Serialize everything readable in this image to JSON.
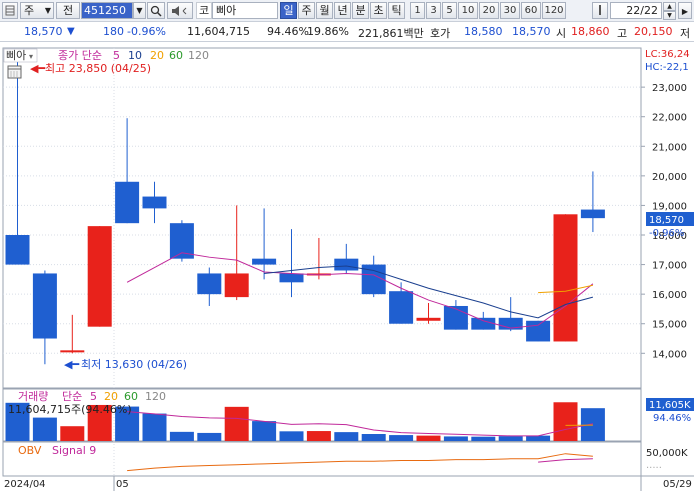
{
  "toolbar": {
    "market": "주",
    "prev_label": "전",
    "code": "451250",
    "exchange": "코",
    "stock_name": "삐아",
    "periods": [
      "일",
      "주",
      "월",
      "년",
      "분",
      "초",
      "틱"
    ],
    "selected_period": "일",
    "intervals": [
      "1",
      "3",
      "5",
      "10",
      "20",
      "30",
      "60",
      "120"
    ],
    "count": "22/22"
  },
  "quote": {
    "price": "18,570",
    "change": "180",
    "change_pct": "-0.96%",
    "volume": "11,604,715",
    "volume_ratio": "94.46%",
    "turnover": "19.86%",
    "amount": "221,861백만",
    "bid_label": "호가",
    "ask_price": "18,580",
    "bid_price": "18,570",
    "open_label": "시",
    "open": "18,860",
    "high_label": "고",
    "high": "20,150",
    "low_label": "저"
  },
  "price_pane": {
    "title": "삐아",
    "ma_label": "종가 단순",
    "ma_periods": [
      "5",
      "10",
      "20",
      "60",
      "120"
    ],
    "lc": "LC:36,24",
    "hc": "HC:-22,1",
    "high_note": "최고 23,850 (04/25)",
    "low_note": "최저 13,630 (04/26)",
    "current_price_tag": "18,570",
    "current_pct_tag": "-0.96%",
    "y_ticks": [
      "23,000",
      "22,000",
      "21,000",
      "20,000",
      "19,000",
      "18,000",
      "17,000",
      "16,000",
      "15,000",
      "14,000"
    ]
  },
  "volume_pane": {
    "title": "거래량",
    "ma_label": "단순",
    "ma_periods": [
      "5",
      "20",
      "60",
      "120"
    ],
    "value_note": "11,604,715주(94.46%)",
    "tag_value": "11,605K",
    "tag_pct": "94.46%"
  },
  "obv_pane": {
    "title": "OBV",
    "signal": "Signal 9",
    "y_tick": "50,000K"
  },
  "x_axis": {
    "labels": [
      "2024/04",
      "05",
      "05/29"
    ]
  },
  "colors": {
    "up": "#e8221b",
    "down": "#1f5fd0",
    "ma5": "#c0289a",
    "ma10": "#1a3f8f",
    "ma20": "#f0a000",
    "ma60": "#2b9a2b"
  },
  "chart_data": {
    "type": "candlestick",
    "days": [
      {
        "o": 18000,
        "h": 23850,
        "l": 18000,
        "c": 17000
      },
      {
        "o": 16700,
        "h": 16800,
        "l": 13630,
        "c": 14500
      },
      {
        "o": 14100,
        "h": 15300,
        "l": 14000,
        "c": 14100
      },
      {
        "o": 14900,
        "h": 18300,
        "l": 14900,
        "c": 18300
      },
      {
        "o": 19800,
        "h": 21950,
        "l": 18400,
        "c": 18400
      },
      {
        "o": 19300,
        "h": 19800,
        "l": 18400,
        "c": 18900
      },
      {
        "o": 18400,
        "h": 18500,
        "l": 17100,
        "c": 17200
      },
      {
        "o": 16700,
        "h": 16900,
        "l": 15600,
        "c": 16000
      },
      {
        "o": 15900,
        "h": 19000,
        "l": 15800,
        "c": 16700
      },
      {
        "o": 17200,
        "h": 18900,
        "l": 16500,
        "c": 17000
      },
      {
        "o": 16700,
        "h": 18200,
        "l": 15900,
        "c": 16400
      },
      {
        "o": 16700,
        "h": 17900,
        "l": 16500,
        "c": 16700
      },
      {
        "o": 17200,
        "h": 17700,
        "l": 16700,
        "c": 16800
      },
      {
        "o": 17000,
        "h": 17300,
        "l": 15900,
        "c": 16000
      },
      {
        "o": 16100,
        "h": 16400,
        "l": 15000,
        "c": 15000
      },
      {
        "o": 15100,
        "h": 15700,
        "l": 15000,
        "c": 15200
      },
      {
        "o": 15600,
        "h": 15800,
        "l": 14800,
        "c": 14800
      },
      {
        "o": 15200,
        "h": 15400,
        "l": 14800,
        "c": 14800
      },
      {
        "o": 15200,
        "h": 15900,
        "l": 14750,
        "c": 14800
      },
      {
        "o": 15100,
        "h": 15100,
        "l": 14400,
        "c": 14400
      },
      {
        "o": 14400,
        "h": 18700,
        "l": 14400,
        "c": 18700
      },
      {
        "o": 18860,
        "h": 20150,
        "l": 18100,
        "c": 18570
      }
    ],
    "ma5": [
      null,
      null,
      null,
      null,
      16400,
      16900,
      17400,
      17250,
      17150,
      16750,
      16700,
      16650,
      16700,
      16650,
      16200,
      15800,
      15500,
      15100,
      14850,
      14950,
      15600,
      16350
    ],
    "ma10": [
      null,
      null,
      null,
      null,
      null,
      null,
      null,
      null,
      null,
      16700,
      16800,
      16900,
      16950,
      16800,
      16500,
      16200,
      15950,
      15700,
      15400,
      15200,
      15650,
      15900
    ],
    "ma20": [
      null,
      null,
      null,
      null,
      null,
      null,
      null,
      null,
      null,
      null,
      null,
      null,
      null,
      null,
      null,
      null,
      null,
      null,
      null,
      16050,
      16100,
      16300
    ],
    "volume": [
      14.2,
      8.7,
      5.5,
      13.4,
      12.8,
      10.2,
      3.4,
      3.0,
      12.7,
      7.4,
      3.6,
      3.7,
      3.3,
      2.6,
      2.2,
      2.0,
      1.7,
      1.6,
      1.8,
      2.0,
      14.4,
      12.2
    ],
    "volume_ma5": [
      null,
      null,
      null,
      null,
      10.9,
      10.1,
      9.1,
      8.6,
      8.4,
      7.3,
      6.2,
      6.4,
      6.1,
      4.1,
      3.1,
      2.8,
      2.5,
      2.2,
      1.9,
      1.9,
      4.3,
      6.4
    ],
    "volume_ma20": [
      null,
      null,
      null,
      null,
      null,
      null,
      null,
      null,
      null,
      null,
      null,
      null,
      null,
      null,
      null,
      null,
      null,
      null,
      null,
      null,
      5.8,
      5.9
    ],
    "obv": [
      null,
      null,
      null,
      null,
      null,
      null,
      null,
      null,
      null,
      null,
      5,
      6,
      8,
      10,
      12,
      13,
      14,
      15,
      16,
      16,
      22,
      19
    ],
    "obv_signal": [
      null,
      null,
      null,
      null,
      null,
      null,
      null,
      null,
      null,
      null,
      null,
      null,
      null,
      null,
      null,
      null,
      null,
      null,
      null,
      14,
      17,
      18
    ],
    "obv_line": [
      null,
      null,
      null,
      null,
      4,
      7,
      9,
      10,
      11,
      12,
      13,
      14,
      15,
      15,
      16,
      16,
      17,
      17,
      18,
      18,
      24,
      21
    ]
  }
}
